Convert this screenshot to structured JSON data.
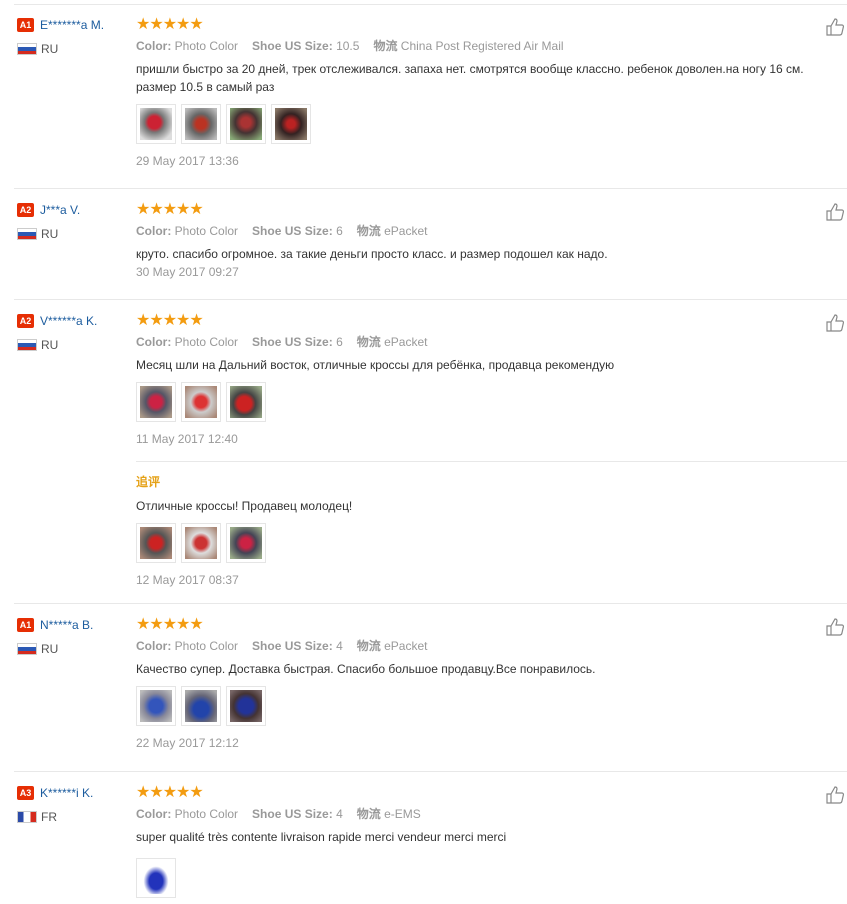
{
  "labels": {
    "color": "Color:",
    "shoe_size": "Shoe US Size:",
    "shipping": "物流",
    "append_title": "追评"
  },
  "colors": {
    "accent_level": "#e62e04",
    "star": "#f39c11",
    "username": "#1c5c9e",
    "append": "#e5a117"
  },
  "reviews": [
    {
      "level": "A1",
      "username": "E*******a M.",
      "country": "RU",
      "flag": "ru-flag-icon",
      "stars": "★★★★★",
      "color_value": "Photo Color",
      "size_value": "10.5",
      "shipping_value": "China Post Registered Air Mail",
      "text": "пришли быстро за 20 дней, трек отслеживался. запаха нет. смотрятся вообще классно. ребенок доволен.на ногу 16 см.",
      "text2": "размер 10.5 в самый раз",
      "photos": 4,
      "date": "29 May 2017 13:36"
    },
    {
      "level": "A2",
      "username": "J***a V.",
      "country": "RU",
      "flag": "ru-flag-icon",
      "stars": "★★★★★",
      "color_value": "Photo Color",
      "size_value": "6",
      "shipping_value": "ePacket",
      "text": "круто. спасибо огромное. за такие деньги просто класс. и размер подошел как надо.",
      "photos": 0,
      "date": "30 May 2017 09:27"
    },
    {
      "level": "A2",
      "username": "V******a K.",
      "country": "RU",
      "flag": "ru-flag-icon",
      "stars": "★★★★★",
      "color_value": "Photo Color",
      "size_value": "6",
      "shipping_value": "ePacket",
      "text": "Месяц шли на Дальний восток, отличные кроссы для ребёнка, продавца рекомендую",
      "photos": 3,
      "date": "11 May 2017 12:40",
      "append": {
        "text": "Отличные кроссы! Продавец молодец!",
        "photos": 3,
        "date": "12 May 2017 08:37"
      }
    },
    {
      "level": "A1",
      "username": "N*****a B.",
      "country": "RU",
      "flag": "ru-flag-icon",
      "stars": "★★★★★",
      "color_value": "Photo Color",
      "size_value": "4",
      "shipping_value": "ePacket",
      "text": "Качество супер. Доставка быстрая. Спасибо большое продавцу.Все понравилось.",
      "photos": 3,
      "date": "22 May 2017 12:12"
    },
    {
      "level": "A3",
      "username": "K******i K.",
      "country": "FR",
      "flag": "fr-flag-icon",
      "stars": "★★★★★",
      "color_value": "Photo Color",
      "size_value": "4",
      "shipping_value": "e-EMS",
      "text": "super qualité très contente livraison rapide merci vendeur merci merci",
      "photos": 1
    }
  ]
}
